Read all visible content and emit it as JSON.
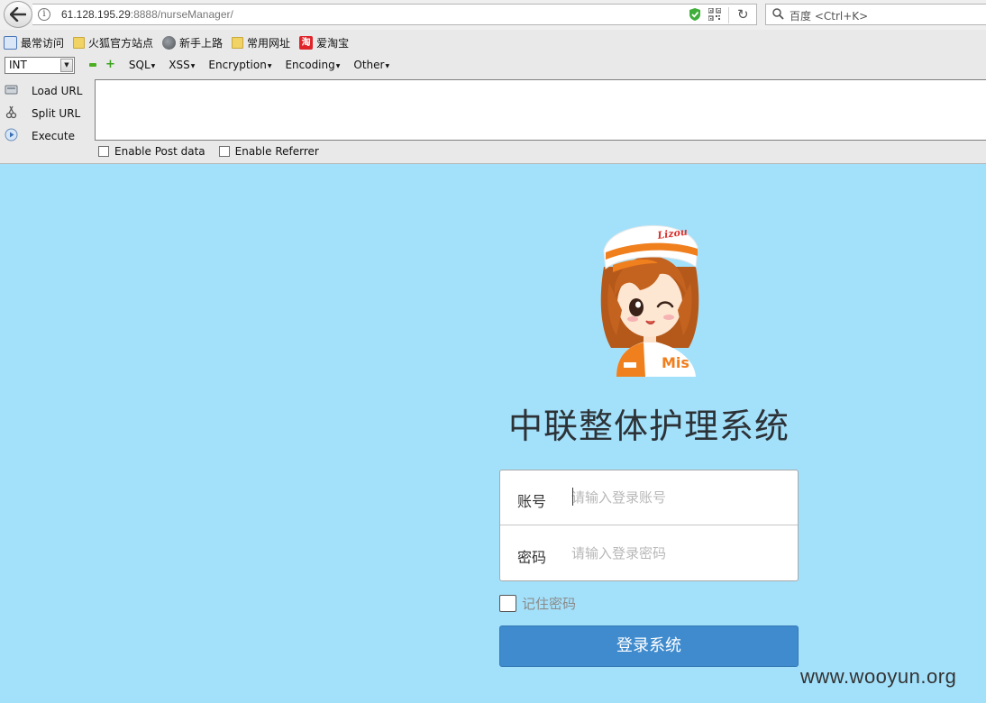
{
  "browser": {
    "url_host": "61.128.195.29",
    "url_rest": ":8888/nurseManager/",
    "search_placeholder": "百度 <Ctrl+K>",
    "bookmarks": [
      {
        "label": "最常访问",
        "icon": "most-visited-icon"
      },
      {
        "label": "火狐官方站点",
        "icon": "folder-icon"
      },
      {
        "label": "新手上路",
        "icon": "globe-icon"
      },
      {
        "label": "常用网址",
        "icon": "folder-icon"
      },
      {
        "label": "爱淘宝",
        "icon": "taobao-icon",
        "icon_text": "淘"
      }
    ]
  },
  "hackbar": {
    "select_value": "INT",
    "menus": [
      "SQL",
      "XSS",
      "Encryption",
      "Encoding",
      "Other"
    ],
    "actions": [
      "Load URL",
      "Split URL",
      "Execute"
    ],
    "url_value": "",
    "checkboxes": [
      "Enable Post data",
      "Enable Referrer"
    ]
  },
  "login": {
    "title": "中联整体护理系统",
    "account_label": "账号",
    "account_placeholder": "请输入登录账号",
    "password_label": "密码",
    "password_placeholder": "请输入登录密码",
    "remember_label": "记住密码",
    "submit_label": "登录系统",
    "mascot_cap_text": "Lizou",
    "mascot_shirt_text": "Mis"
  },
  "watermark": "www.wooyun.org",
  "colors": {
    "page_background": "#a3e1fb",
    "button": "#3f8bce",
    "mascot_orange": "#f07f1e"
  }
}
